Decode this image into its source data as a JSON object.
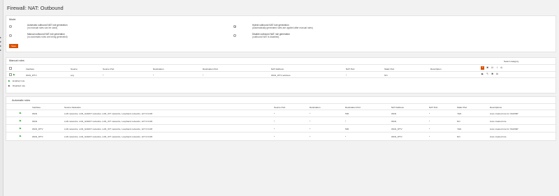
{
  "page": {
    "title": "Firewall: NAT: Outbound"
  },
  "mode": {
    "section_label": "Mode",
    "options": [
      {
        "line1": "Automatic outbound NAT rule generation",
        "line2": "(no manual rules can be used)",
        "selected": false
      },
      {
        "line1": "Hybrid outbound NAT rule generation",
        "line2": "(automatically generated rules are applied after manual rules)",
        "selected": true
      },
      {
        "line1": "Manual outbound NAT rule generation",
        "line2": "(no automatic rules are being generated)",
        "selected": false
      },
      {
        "line1": "Disable outbound NAT rule generation",
        "line2": "(outbound NAT is disabled)",
        "selected": false
      }
    ],
    "save_label": "Save"
  },
  "manual": {
    "section_label": "Manual rules",
    "select_category": "Select category",
    "columns": [
      "Interface",
      "Source",
      "Source Port",
      "Destination",
      "Destination Port",
      "NAT Address",
      "NAT Port",
      "Static Port",
      "Description"
    ],
    "rows": [
      {
        "interface": "WAN_IPTV",
        "source": "any",
        "source_port": "*",
        "destination": "*",
        "destination_port": "*",
        "nat_address": "WAN_IPTV address",
        "nat_port": "*",
        "static_port": "NO",
        "description": ""
      }
    ],
    "legend": [
      {
        "icon": "play-green-icon",
        "label": "Enabled rule"
      },
      {
        "icon": "play-grey-icon",
        "label": "Disabled rule"
      }
    ]
  },
  "automatic": {
    "section_label": "Automatic rules",
    "columns": [
      "Interface",
      "Source Networks",
      "Source Port",
      "Destination",
      "Destination Port",
      "NAT Address",
      "NAT Port",
      "Static Port",
      "Descriptions"
    ],
    "rows": [
      {
        "interface": "WAN",
        "source_networks": "LAN networks, LAN_GUEST networks, LAN_IOT networks, Loopback networks, 127.0.0.0/8",
        "source_port": "*",
        "destination": "*",
        "destination_port": "500",
        "nat_address": "WAN",
        "nat_port": "*",
        "static_port": "YES",
        "description": "Auto created rule for ISAKMP"
      },
      {
        "interface": "WAN",
        "source_networks": "LAN networks, LAN_GUEST networks, LAN_IOT networks, Loopback networks, 127.0.0.0/8",
        "source_port": "*",
        "destination": "*",
        "destination_port": "*",
        "nat_address": "WAN",
        "nat_port": "*",
        "static_port": "NO",
        "description": "Auto created rule"
      },
      {
        "interface": "WAN_IPTV",
        "source_networks": "LAN networks, LAN_GUEST networks, LAN_IOT networks, Loopback networks, 127.0.0.0/8",
        "source_port": "*",
        "destination": "*",
        "destination_port": "500",
        "nat_address": "WAN_IPTV",
        "nat_port": "*",
        "static_port": "YES",
        "description": "Auto created rule for ISAKMP"
      },
      {
        "interface": "WAN_IPTV",
        "source_networks": "LAN networks, LAN_GUEST networks, LAN_IOT networks, Loopback networks, 127.0.0.0/8",
        "source_port": "*",
        "destination": "*",
        "destination_port": "*",
        "nat_address": "WAN_IPTV",
        "nat_port": "*",
        "static_port": "NO",
        "description": "Auto created rule"
      }
    ]
  },
  "icons": {
    "play": "▶",
    "plus": "+",
    "delete": "✖",
    "power": "⏻",
    "edit": "✎",
    "copy": "⧉",
    "info": "i",
    "search": "⊙",
    "accent_color": "#d94f00",
    "enabled_color": "#2e9e30"
  }
}
